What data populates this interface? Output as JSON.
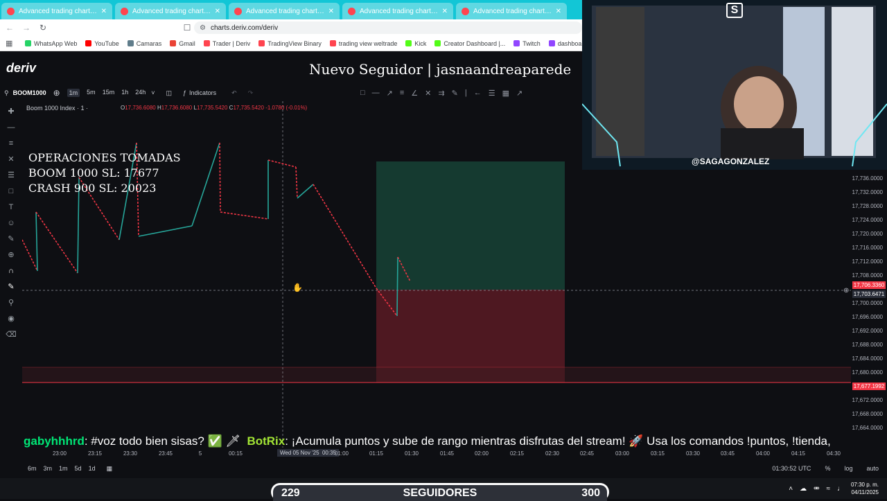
{
  "browser": {
    "tabs": [
      {
        "title": "Advanced trading charts & tools | Deriv"
      },
      {
        "title": "Advanced trading charts & tools | Deriv"
      },
      {
        "title": "Advanced trading charts & tools | Deriv"
      },
      {
        "title": "Advanced trading charts & tools | Deriv"
      },
      {
        "title": "Advanced trading charts & tools | Deriv"
      }
    ],
    "url": "charts.deriv.com/deriv",
    "bookmarks": [
      {
        "label": "WhatsApp Web",
        "color": "#25d366"
      },
      {
        "label": "YouTube",
        "color": "#ff0000"
      },
      {
        "label": "Camaras",
        "color": "#607d8b"
      },
      {
        "label": "Gmail",
        "color": "#ea4335"
      },
      {
        "label": "Trader | Deriv",
        "color": "#ff444f"
      },
      {
        "label": "TradingView Binary",
        "color": "#ff444f"
      },
      {
        "label": "trading view weltrade",
        "color": "#ff444f"
      },
      {
        "label": "Kick",
        "color": "#53fc18"
      },
      {
        "label": "Creator Dashboard |...",
        "color": "#53fc18"
      },
      {
        "label": "Twitch",
        "color": "#9146ff"
      },
      {
        "label": "dashboard twitch",
        "color": "#9146ff"
      }
    ]
  },
  "app": {
    "logo": "deriv",
    "follower_alert": "Nuevo Seguidor | jasnaandreaparede"
  },
  "toolbar": {
    "symbol": "BOOM1000",
    "timeframes": [
      "1m",
      "5m",
      "15m",
      "1h",
      "24h"
    ],
    "active_timeframe": "1m",
    "indicators_label": "Indicators"
  },
  "chart": {
    "legend_title": "Boom 1000 Index · 1 ·",
    "ohlc": {
      "o": "17,736.6080",
      "h": "17,736.6080",
      "l": "17,735.5420",
      "c": "17,735.5420",
      "change": "-1.0780 (-0.01%)"
    },
    "overlay_lines": [
      "OPERACIONES TOMADAS",
      "BOOM 1000 SL: 17677",
      "CRASH 900 SL: 20023"
    ],
    "y_ticks": [
      "17,736.0000",
      "17,732.0000",
      "17,728.0000",
      "17,724.0000",
      "17,720.0000",
      "17,716.0000",
      "17,712.0000",
      "17,708.0000",
      "17,700.0000",
      "17,696.0000",
      "17,692.0000",
      "17,688.0000",
      "17,684.0000",
      "17,680.0000",
      "17,672.0000",
      "17,668.0000",
      "17,664.0000"
    ],
    "price_labels": {
      "current": "17,706.3360",
      "crosshair": "17,703.6471",
      "stop": "17,677.1992"
    },
    "x_ticks": [
      "23:00",
      "23:15",
      "23:30",
      "23:45",
      "5",
      "00:15",
      "00:35",
      "01:00",
      "01:15",
      "01:30",
      "01:45",
      "02:00",
      "02:15",
      "02:30",
      "02:45",
      "03:00",
      "03:15",
      "03:30",
      "03:45",
      "04:00",
      "04:15",
      "04:30"
    ],
    "x_cursor_label": "Wed 05 Nov '25",
    "x_cursor_time": "00:35",
    "colors": {
      "down": "#f23645",
      "up": "#26a69a",
      "profit": "#1b5e48",
      "loss": "#7a1e2c"
    }
  },
  "ticker": {
    "user1": "gabyhhhrd",
    "msg1": ": #voz todo bien sisas? ✅ 🗡",
    "user2": "BotRix",
    "msg2": ": ¡Acumula puntos y sube de rango mientras disfrutas del stream! 🚀 Usa los comandos !puntos, !tienda,"
  },
  "bottom": {
    "ranges": [
      "6m",
      "3m",
      "1m",
      "5d",
      "1d"
    ],
    "time": "01:30:52 UTC",
    "pct": "%",
    "log": "log",
    "auto": "auto"
  },
  "followers": {
    "current": "229",
    "label": "SEGUIDORES",
    "goal": "300"
  },
  "taskbar": {
    "time": "07:30 p. m.",
    "date": "04/11/2025"
  },
  "webcam": {
    "handle": "@SAGAGONZALEZ",
    "logo": "S"
  }
}
